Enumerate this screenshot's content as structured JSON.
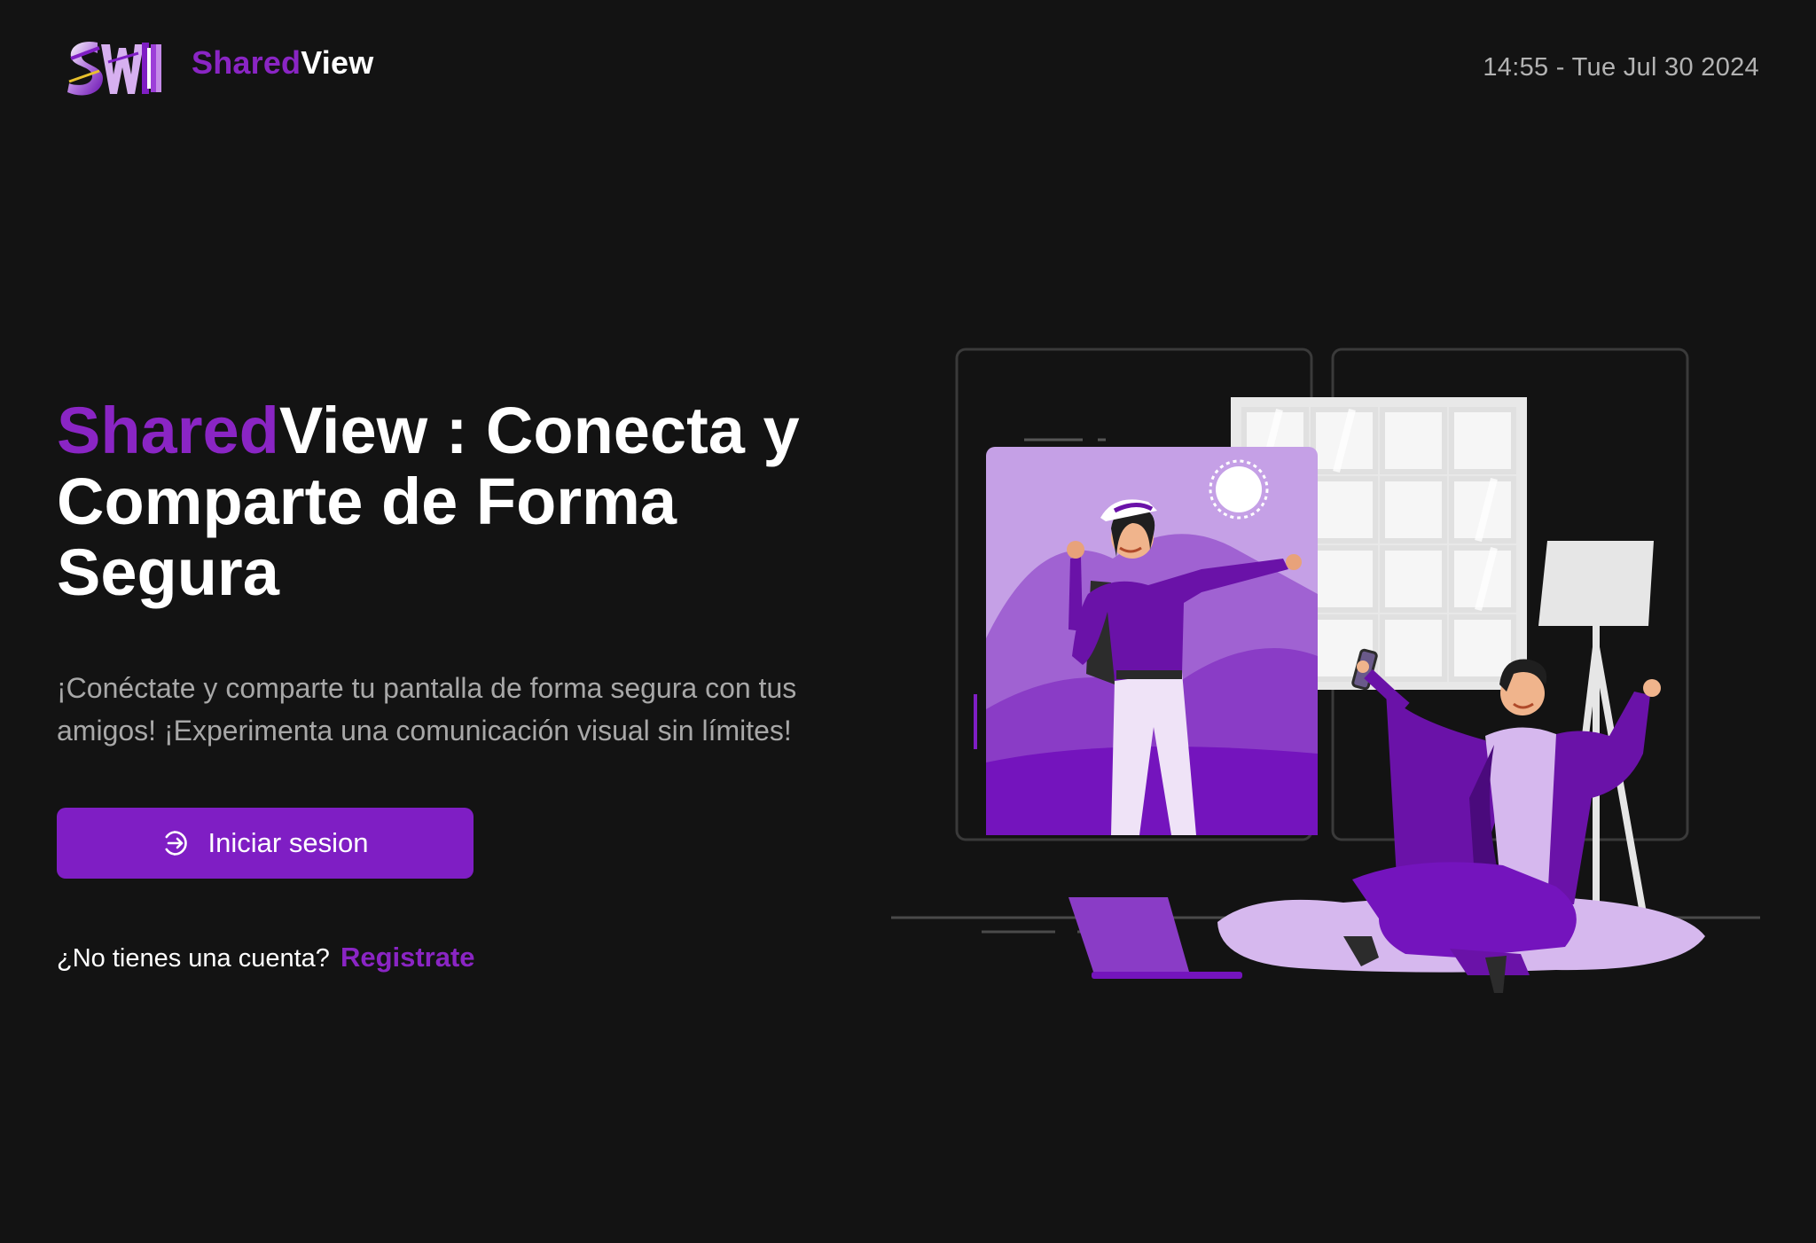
{
  "header": {
    "brand_part1": "Shared",
    "brand_part2": "View",
    "datetime": "14:55 - Tue Jul 30 2024",
    "logo_icon": "sv-logo"
  },
  "hero": {
    "title_part1": "Shared",
    "title_part2": "View : Conecta y Comparte de Forma Segura",
    "description": "¡Conéctate y comparte tu pantalla de forma segura con tus amigos! ¡Experimenta una comunicación visual sin límites!",
    "login_label": "Iniciar sesion",
    "login_icon": "login-arrow-icon",
    "signup_prompt": "¿No tienes una cuenta?",
    "signup_link": "Registrate"
  },
  "colors": {
    "background": "#131313",
    "accent": "#7f1ec4",
    "accent_text": "#8a25c4",
    "muted_text": "#a8a8a8"
  }
}
